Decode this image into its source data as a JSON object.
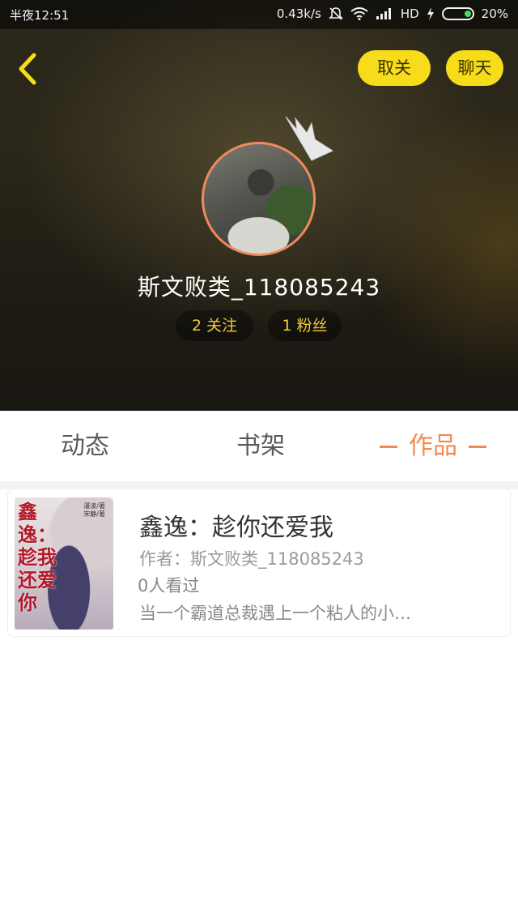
{
  "status_bar": {
    "time": "半夜12:51",
    "net_speed": "0.43k/s",
    "network_type": "HD",
    "battery": "20%",
    "battery_level": 0.2
  },
  "header": {
    "back_icon": "chevron-left-icon",
    "unfollow_label": "取关",
    "chat_label": "聊天"
  },
  "profile": {
    "username": "斯文败类_118085243",
    "following_count": "2",
    "following_label": "关注",
    "fans_count": "1",
    "fans_label": "粉丝"
  },
  "tabs": [
    {
      "label": "动态",
      "active": false
    },
    {
      "label": "书架",
      "active": false
    },
    {
      "label": "作品",
      "active": true
    }
  ],
  "works": [
    {
      "cover_text": "鑫逸：趁我还爱你",
      "cover_credit": [
        "漫凌/著",
        "宋静/著"
      ],
      "title": "鑫逸：趁你还爱我",
      "author": "作者：斯文败类_118085243",
      "views": "0人看过",
      "description": "当一个霸道总裁遇上一个粘人的小…"
    }
  ],
  "colors": {
    "accent_yellow": "#f7dc1a",
    "accent_orange": "#f28a4f",
    "stat_text": "#f3c93b",
    "avatar_border": "#f08a5d"
  }
}
